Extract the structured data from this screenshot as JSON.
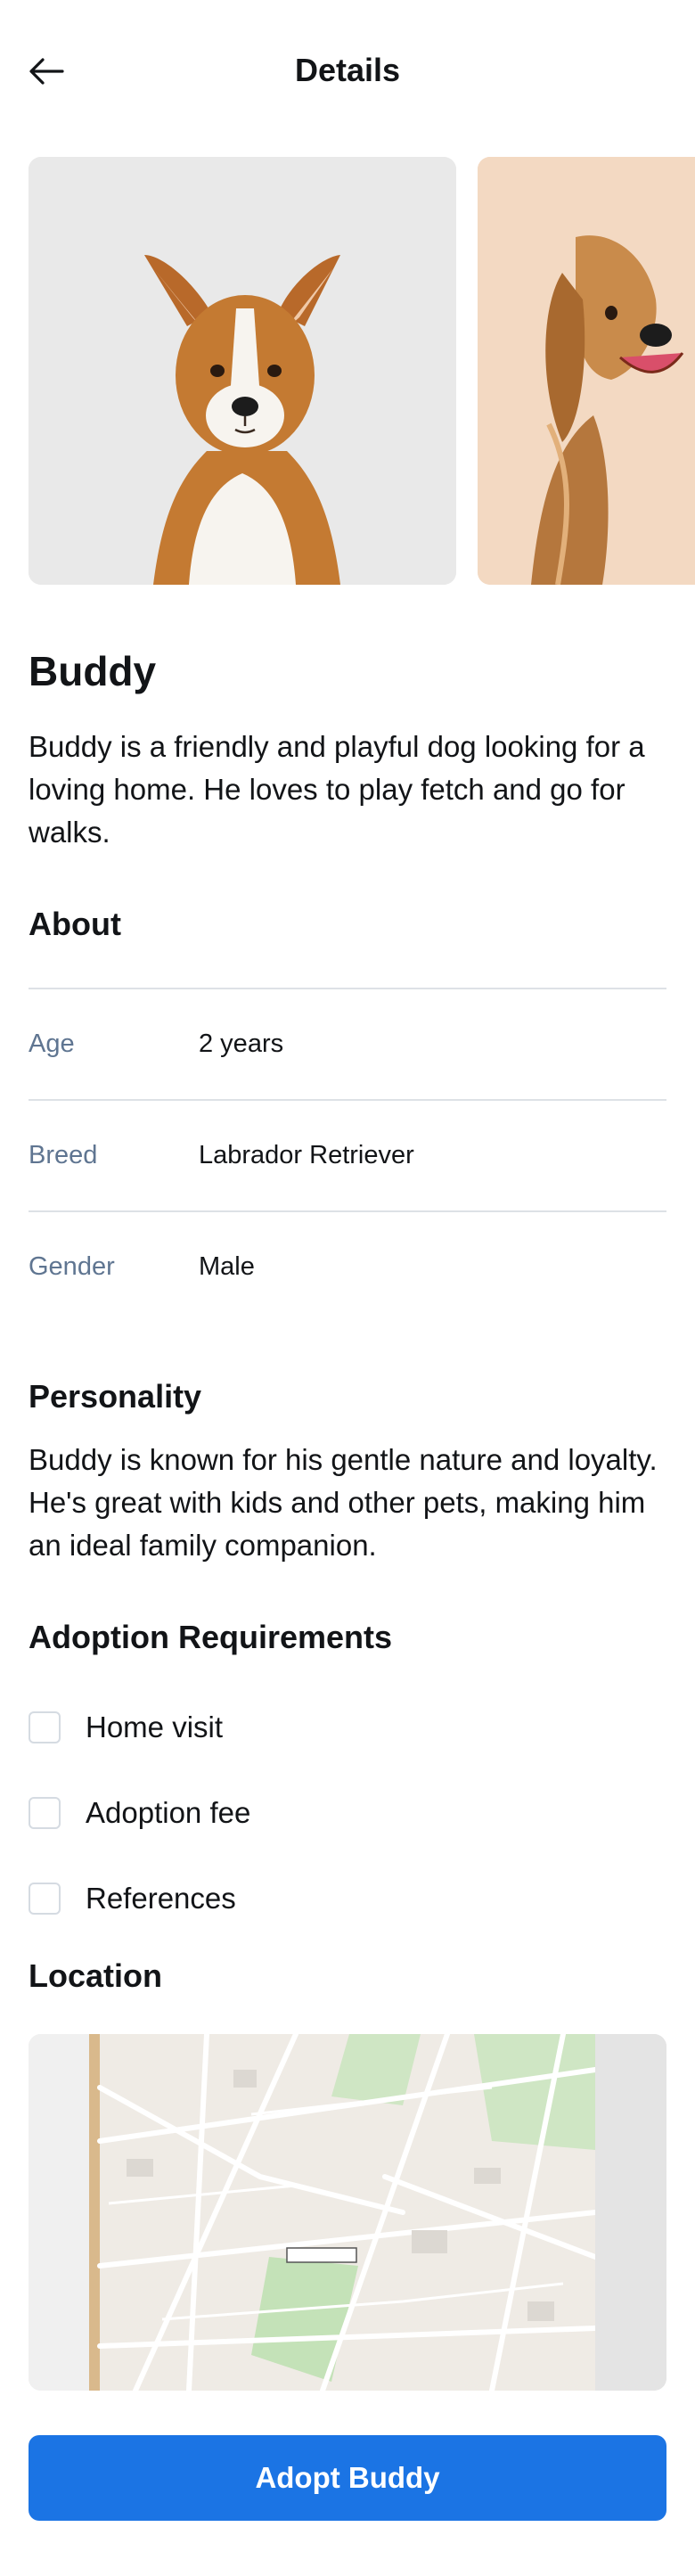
{
  "header": {
    "title": "Details",
    "back_icon": "arrow-left-icon"
  },
  "gallery": {
    "photos": [
      {
        "subject": "corgi-mix dog sitting",
        "background": "#e9e9e9"
      },
      {
        "subject": "golden retriever illustration",
        "background": "#f3d9c2"
      }
    ]
  },
  "pet": {
    "name": "Buddy",
    "description": "Buddy is a friendly and playful dog looking for a loving home. He loves to play fetch and go for walks."
  },
  "about": {
    "title": "About",
    "rows": [
      {
        "label": "Age",
        "value": "2 years"
      },
      {
        "label": "Breed",
        "value": "Labrador Retriever"
      },
      {
        "label": "Gender",
        "value": "Male"
      }
    ]
  },
  "personality": {
    "title": "Personality",
    "text": "Buddy is known for his gentle nature and loyalty. He's great with kids and other pets, making him an ideal family companion."
  },
  "requirements": {
    "title": "Adoption Requirements",
    "items": [
      {
        "label": "Home visit",
        "checked": false
      },
      {
        "label": "Adoption fee",
        "checked": false
      },
      {
        "label": "References",
        "checked": false
      }
    ]
  },
  "location": {
    "title": "Location"
  },
  "cta": {
    "label": "Adopt Buddy"
  },
  "colors": {
    "accent": "#1b74e4",
    "muted_label": "#5f7591",
    "divider": "#dde1e6",
    "text": "#121417"
  }
}
